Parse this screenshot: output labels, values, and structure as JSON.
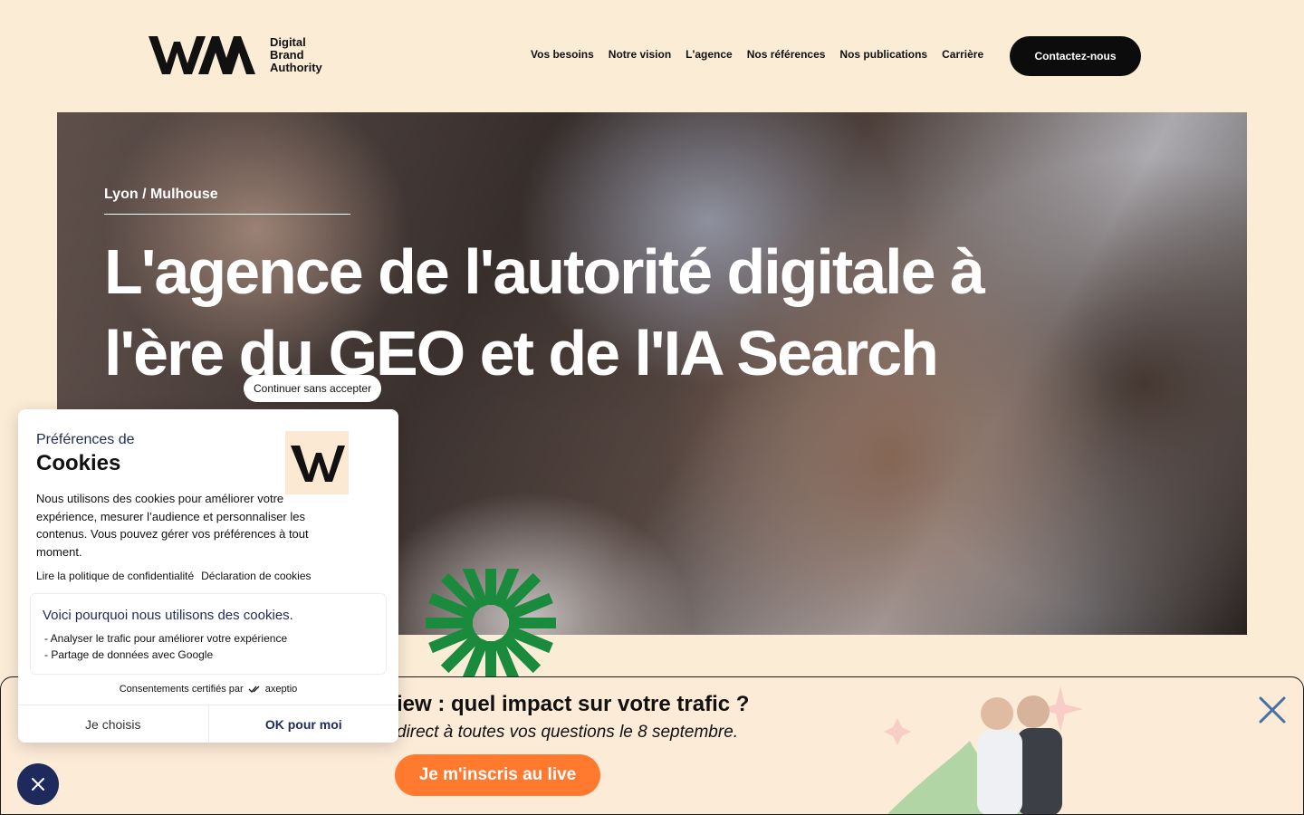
{
  "header": {
    "logo_lines": [
      "Digital",
      "Brand",
      "Authority"
    ],
    "nav": [
      "Vos besoins",
      "Notre vision",
      "L'agence",
      "Nos références",
      "Nos publications",
      "Carrière"
    ],
    "cta": "Contactez-nous"
  },
  "hero": {
    "location": "Lyon / Mulhouse",
    "title_line1": "L'agence de l'autorité digitale à",
    "title_line2": "l'ère du GEO et de l'IA Search"
  },
  "banner": {
    "title": "iew : quel impact sur votre trafic ?",
    "subtitle": "direct à toutes vos questions le 8 septembre.",
    "button": "Je m'inscris au live",
    "close_icon": "close-icon"
  },
  "cookie": {
    "continue": "Continuer sans accepter",
    "kicker": "Préférences de",
    "title": "Cookies",
    "description": "Nous utilisons des cookies pour améliorer votre expérience, mesurer l’audience et personnaliser les contenus. Vous pouvez gérer vos préférences à tout moment.",
    "link_privacy": "Lire la politique de confidentialité",
    "link_declaration": "Déclaration de cookies",
    "box_title": "Voici pourquoi nous utilisons des cookies.",
    "reasons": [
      "- Analyser le trafic pour améliorer votre expérience",
      "- Partage de données avec Google"
    ],
    "certified": "Consentements certifiés par",
    "certified_brand": "axeptio",
    "btn_choose": "Je choisis",
    "btn_ok": "OK pour moi"
  },
  "colors": {
    "page_bg": "#fbecd6",
    "accent_orange": "#ff7a2e",
    "accent_green": "#1a8a3c",
    "cookie_navy": "#1f2a5c"
  }
}
